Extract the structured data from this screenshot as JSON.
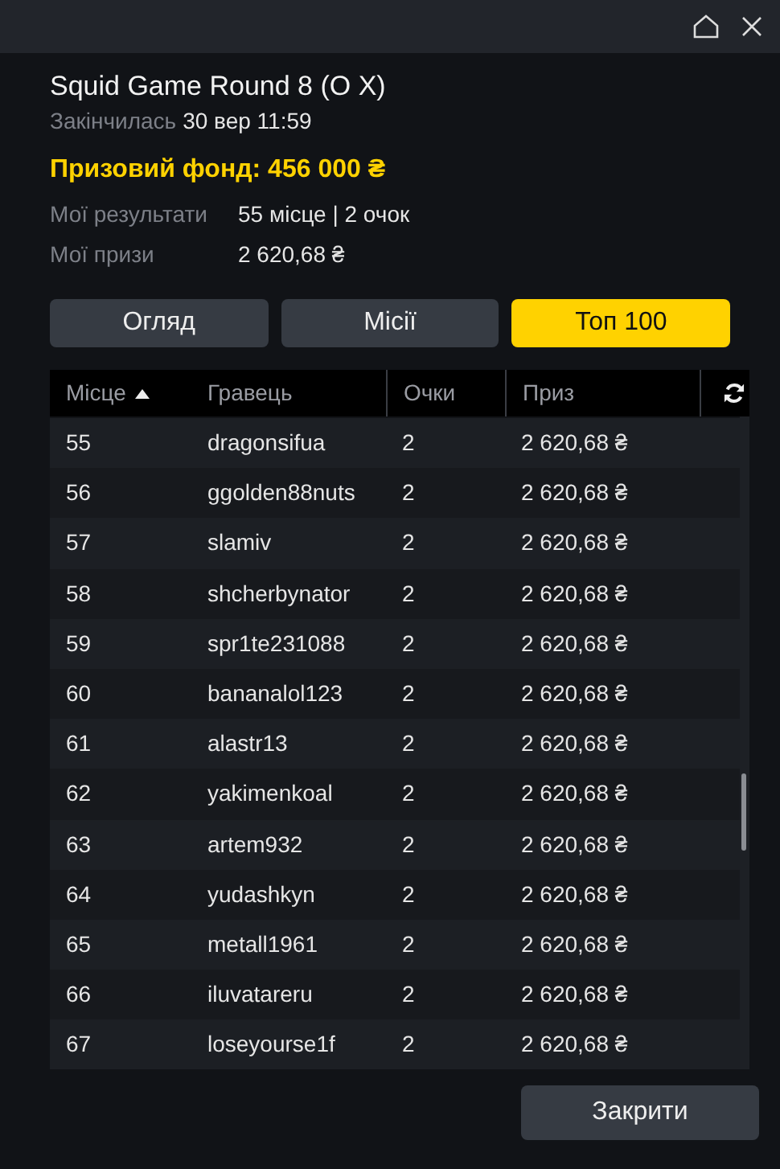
{
  "title": "Squid Game Round 8 (O X)",
  "ended": {
    "label": "Закінчилась",
    "value": "30 вер 11:59"
  },
  "prize_fund": "Призовий фонд: 456 000 ₴",
  "stats": [
    {
      "label": "Мої результати",
      "value": "55 місце | 2 очок"
    },
    {
      "label": "Мої призи",
      "value": "2 620,68 ₴"
    }
  ],
  "tabs": [
    {
      "label": "Огляд",
      "selected": false
    },
    {
      "label": "Місії",
      "selected": false
    },
    {
      "label": "Топ 100",
      "selected": true
    }
  ],
  "table": {
    "columns": [
      {
        "label": "Місце",
        "sorted": true
      },
      {
        "label": "Гравець",
        "sorted": false
      },
      {
        "label": "Очки",
        "sorted": false
      },
      {
        "label": "Приз",
        "sorted": false
      }
    ],
    "rows": [
      [
        "55",
        "dragonsifua",
        "2",
        "2 620,68 ₴"
      ],
      [
        "56",
        "ggolden88nuts",
        "2",
        "2 620,68 ₴"
      ],
      [
        "57",
        "slamiv",
        "2",
        "2 620,68 ₴"
      ],
      [
        "58",
        "shcherbynator",
        "2",
        "2 620,68 ₴"
      ],
      [
        "59",
        "spr1te231088",
        "2",
        "2 620,68 ₴"
      ],
      [
        "60",
        "bananalol123",
        "2",
        "2 620,68 ₴"
      ],
      [
        "61",
        "alastr13",
        "2",
        "2 620,68 ₴"
      ],
      [
        "62",
        "yakimenkoal",
        "2",
        "2 620,68 ₴"
      ],
      [
        "63",
        "artem932",
        "2",
        "2 620,68 ₴"
      ],
      [
        "64",
        "yudashkyn",
        "2",
        "2 620,68 ₴"
      ],
      [
        "65",
        "metall1961",
        "2",
        "2 620,68 ₴"
      ],
      [
        "66",
        "iluvatareru",
        "2",
        "2 620,68 ₴"
      ],
      [
        "67",
        "loseyourse1f",
        "2",
        "2 620,68 ₴"
      ]
    ]
  },
  "close_button": "Закрити"
}
